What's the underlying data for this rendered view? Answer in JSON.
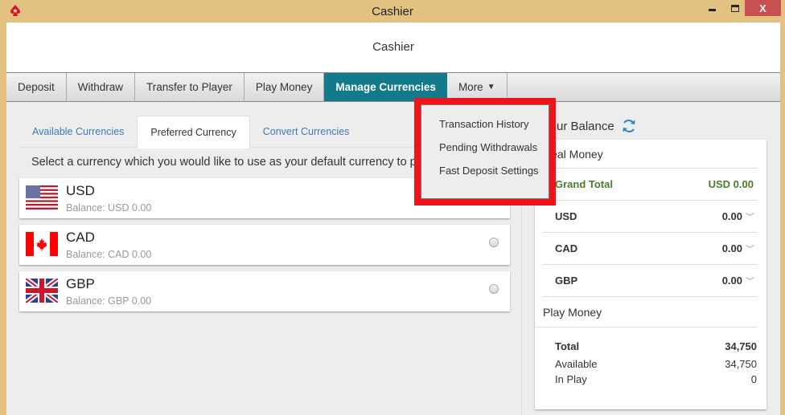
{
  "window": {
    "title": "Cashier",
    "controls": {
      "minimize": "minimize",
      "maximize": "maximize",
      "close": "X"
    }
  },
  "header": {
    "title": "Cashier"
  },
  "tabs": [
    {
      "label": "Deposit",
      "active": false
    },
    {
      "label": "Withdraw",
      "active": false
    },
    {
      "label": "Transfer to Player",
      "active": false
    },
    {
      "label": "Play Money",
      "active": false
    },
    {
      "label": "Manage Currencies",
      "active": true
    },
    {
      "label": "More",
      "active": false
    }
  ],
  "more_menu": {
    "items": [
      "Transaction History",
      "Pending Withdrawals",
      "Fast Deposit Settings"
    ]
  },
  "manage_currencies": {
    "subtabs": [
      {
        "label": "Available Currencies",
        "active": false
      },
      {
        "label": "Preferred Currency",
        "active": true
      },
      {
        "label": "Convert Currencies",
        "active": false
      }
    ],
    "instruction": "Select a currency which you would like to use as your default currency to play",
    "currencies": [
      {
        "code": "USD",
        "balance": "Balance: USD 0.00",
        "selected": true
      },
      {
        "code": "CAD",
        "balance": "Balance: CAD 0.00",
        "selected": false
      },
      {
        "code": "GBP",
        "balance": "Balance: GBP 0.00",
        "selected": false
      }
    ]
  },
  "balance": {
    "title": "Your Balance",
    "real_money": {
      "title": "Real Money",
      "grand_total_label": "Grand Total",
      "grand_total_value": "USD 0.00",
      "rows": [
        {
          "label": "USD",
          "value": "0.00"
        },
        {
          "label": "CAD",
          "value": "0.00"
        },
        {
          "label": "GBP",
          "value": "0.00"
        }
      ]
    },
    "play_money": {
      "title": "Play Money",
      "total_label": "Total",
      "total_value": "34,750",
      "available_label": "Available",
      "available_value": "34,750",
      "in_play_label": "In Play",
      "in_play_value": "0"
    }
  },
  "colors": {
    "titlebar": "#e3c281",
    "active_tab": "#137a8b",
    "grand_total": "#4a7c2c",
    "highlight_box": "#f0141a",
    "close_button": "#c75050"
  }
}
